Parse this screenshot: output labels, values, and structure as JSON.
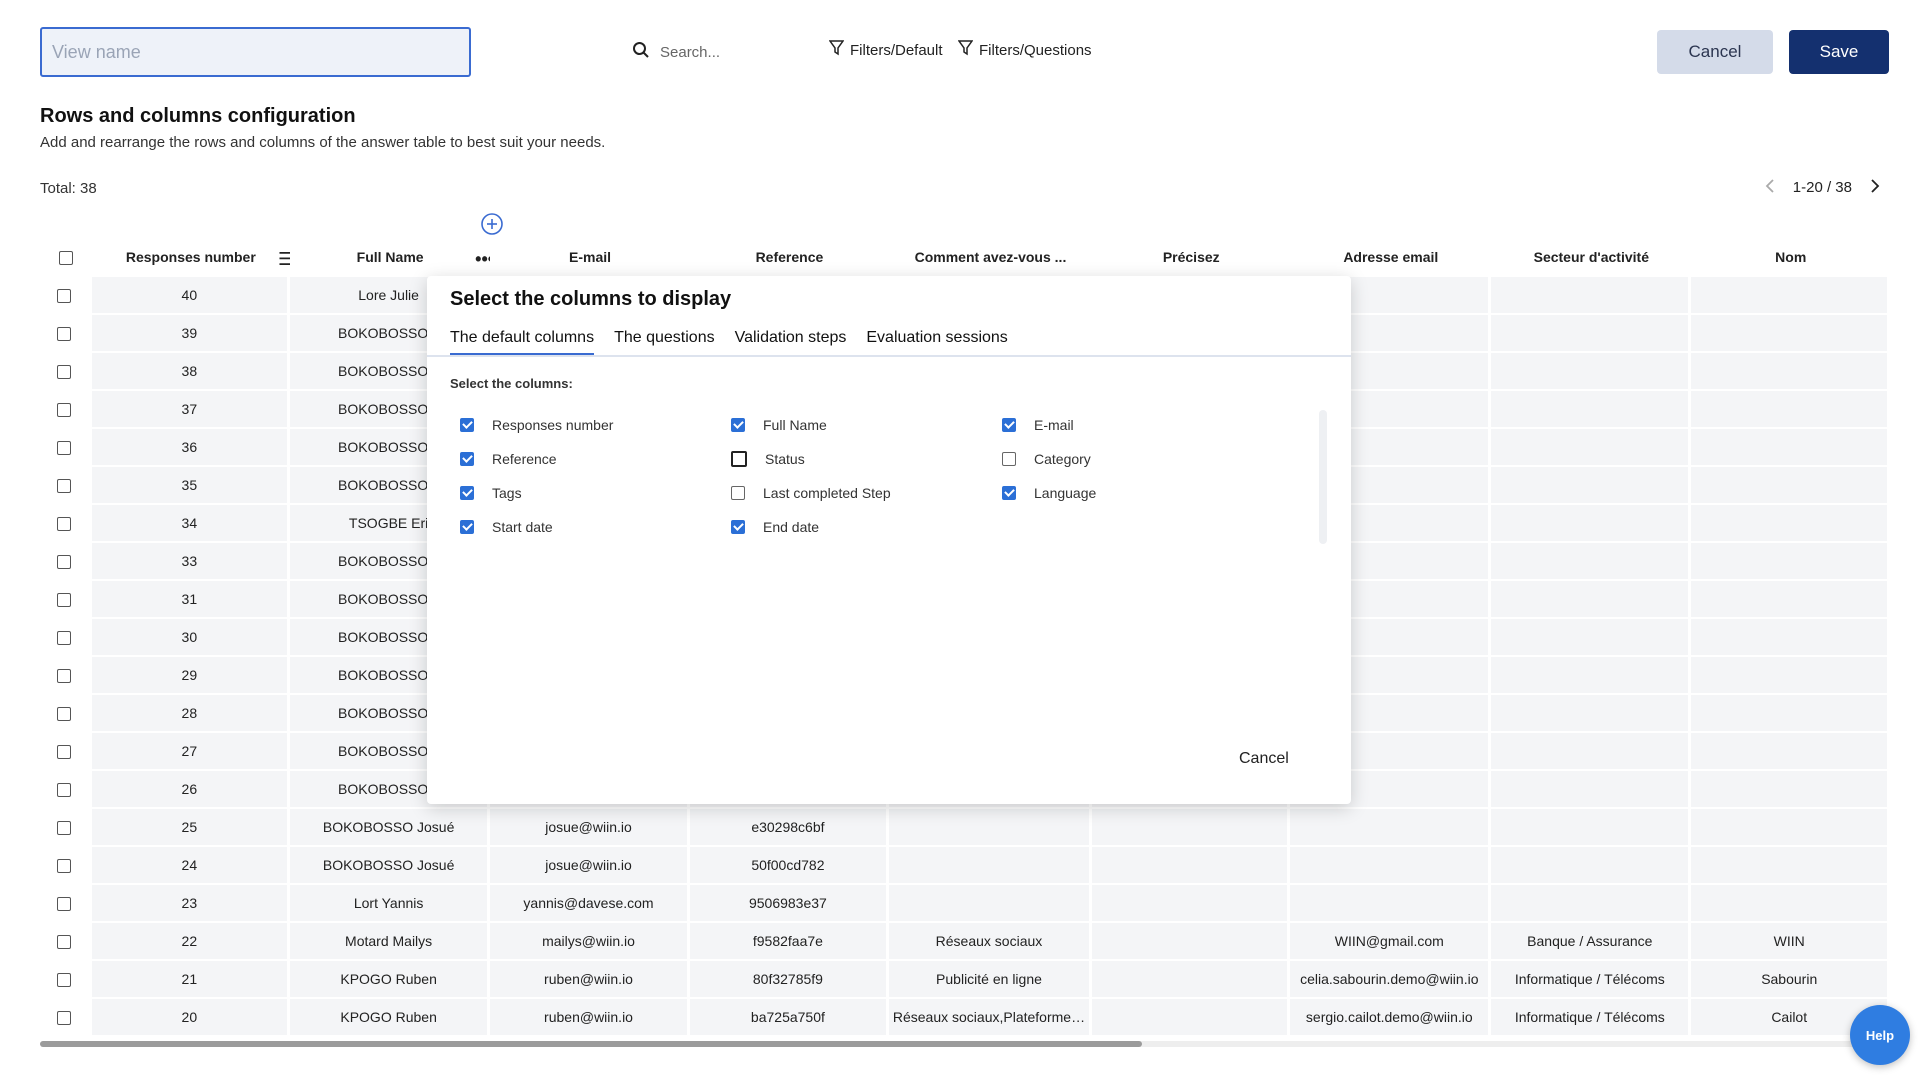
{
  "topbar": {
    "view_name_placeholder": "View name",
    "search_placeholder": "Search...",
    "filter_default": "Filters/Default",
    "filter_questions": "Filters/Questions",
    "cancel_label": "Cancel",
    "save_label": "Save"
  },
  "colors": {
    "primary": "#14306f",
    "accent": "#3a6bd1",
    "checkbox": "#2b6fd6",
    "help": "#2f7de1"
  },
  "header": {
    "title": "Rows and columns configuration",
    "subtitle": "Add and rearrange the rows and columns of the answer table to best suit your needs."
  },
  "total": "Total: 38",
  "pagination": {
    "range": "1-20 / 38"
  },
  "table": {
    "columns": [
      "Responses number",
      "Full Name",
      "E-mail",
      "Reference",
      "Comment avez-vous ...",
      "Précisez",
      "Adresse email",
      "Secteur d'activité",
      "Nom"
    ],
    "rows": [
      [
        "40",
        "Lore Julie",
        "",
        "",
        "",
        "",
        "",
        "",
        ""
      ],
      [
        "39",
        "BOKOBOSSO J",
        "",
        "",
        "",
        "",
        "",
        "",
        ""
      ],
      [
        "38",
        "BOKOBOSSO J",
        "",
        "",
        "",
        "",
        "",
        "",
        ""
      ],
      [
        "37",
        "BOKOBOSSO J",
        "",
        "",
        "",
        "",
        "",
        "",
        ""
      ],
      [
        "36",
        "BOKOBOSSO J",
        "",
        "",
        "",
        "",
        "",
        "",
        ""
      ],
      [
        "35",
        "BOKOBOSSO J",
        "",
        "",
        "",
        "",
        "",
        "",
        ""
      ],
      [
        "34",
        "TSOGBE Eri",
        "",
        "",
        "",
        "",
        "",
        "",
        ""
      ],
      [
        "33",
        "BOKOBOSSO J",
        "",
        "",
        "",
        "",
        "",
        "",
        ""
      ],
      [
        "31",
        "BOKOBOSSO J",
        "",
        "",
        "",
        "",
        "",
        "",
        ""
      ],
      [
        "30",
        "BOKOBOSSO J",
        "",
        "",
        "",
        "",
        "",
        "",
        ""
      ],
      [
        "29",
        "BOKOBOSSO J",
        "",
        "",
        "",
        "",
        "",
        "",
        ""
      ],
      [
        "28",
        "BOKOBOSSO J",
        "",
        "",
        "",
        "",
        "",
        "",
        ""
      ],
      [
        "27",
        "BOKOBOSSO J",
        "",
        "",
        "",
        "",
        "",
        "",
        ""
      ],
      [
        "26",
        "BOKOBOSSO J",
        "",
        "",
        "",
        "",
        "",
        "",
        ""
      ],
      [
        "25",
        "BOKOBOSSO Josué",
        "josue@wiin.io",
        "e30298c6bf",
        "",
        "",
        "",
        "",
        ""
      ],
      [
        "24",
        "BOKOBOSSO Josué",
        "josue@wiin.io",
        "50f00cd782",
        "",
        "",
        "",
        "",
        ""
      ],
      [
        "23",
        "Lort Yannis",
        "yannis@davese.com",
        "9506983e37",
        "",
        "",
        "",
        "",
        ""
      ],
      [
        "22",
        "Motard Mailys",
        "mailys@wiin.io",
        "f9582faa7e",
        "Réseaux sociaux",
        "",
        "WIIN@gmail.com",
        "Banque / Assurance",
        "WIIN"
      ],
      [
        "21",
        "KPOGO Ruben",
        "ruben@wiin.io",
        "80f32785f9",
        "Publicité en ligne",
        "",
        "celia.sabourin.demo@wiin.io",
        "Informatique / Télécoms",
        "Sabourin"
      ],
      [
        "20",
        "KPOGO Ruben",
        "ruben@wiin.io",
        "ba725a750f",
        "Réseaux sociaux,Plateforme…",
        "",
        "sergio.cailot.demo@wiin.io",
        "Informatique / Télécoms",
        "Cailot"
      ]
    ]
  },
  "modal": {
    "title": "Select the columns to display",
    "tabs": [
      "The default columns",
      "The questions",
      "Validation steps",
      "Evaluation sessions"
    ],
    "label": "Select the columns:",
    "options": [
      {
        "label": "Responses number",
        "checked": true
      },
      {
        "label": "Full Name",
        "checked": true
      },
      {
        "label": "E-mail",
        "checked": true
      },
      {
        "label": "Reference",
        "checked": true
      },
      {
        "label": "Status",
        "checked": false,
        "focused": true
      },
      {
        "label": "Category",
        "checked": false
      },
      {
        "label": "Tags",
        "checked": true
      },
      {
        "label": "Last completed Step",
        "checked": false
      },
      {
        "label": "Language",
        "checked": true
      },
      {
        "label": "Start date",
        "checked": true
      },
      {
        "label": "End date",
        "checked": true
      }
    ],
    "cancel_label": "Cancel"
  },
  "help_label": "Help"
}
